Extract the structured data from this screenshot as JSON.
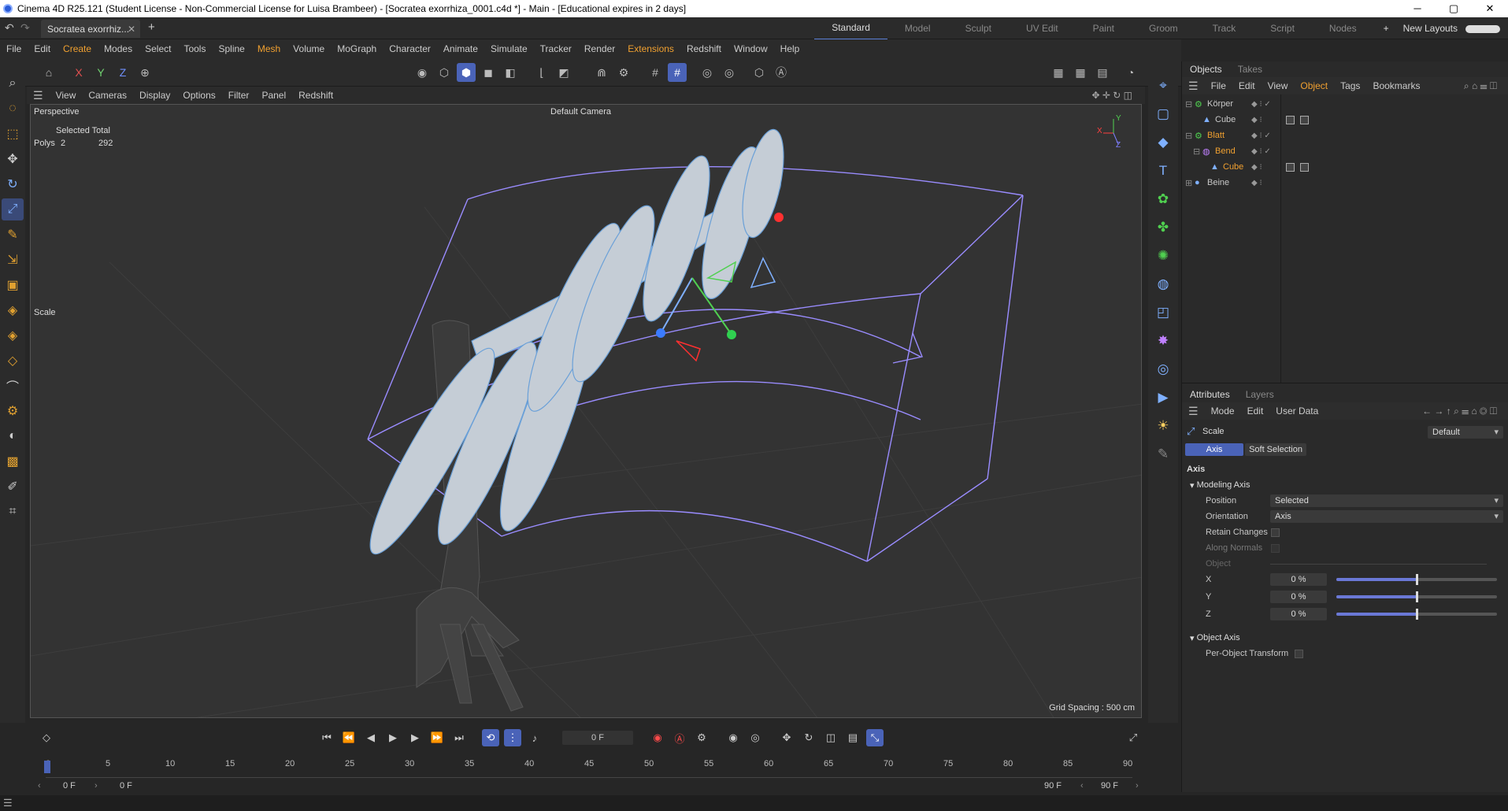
{
  "titlebar": {
    "title": "Cinema 4D R25.121 (Student License - Non-Commercial License for Luisa Brambeer) - [Socratea exorrhiza_0001.c4d *] - Main - [Educational expires in 2 days]",
    "minimize": "─",
    "maximize": "▢",
    "close": "✕"
  },
  "tabs": {
    "doc_tab": "Socratea exorrhiz...",
    "close": "✕",
    "add": "+"
  },
  "layouts": {
    "items": [
      "Standard",
      "Model",
      "Sculpt",
      "UV Edit",
      "Paint",
      "Groom",
      "Track",
      "Script",
      "Nodes"
    ],
    "add": "+",
    "new_layouts": "New Layouts"
  },
  "menu": {
    "items": [
      "File",
      "Edit",
      "Create",
      "Modes",
      "Select",
      "Tools",
      "Spline",
      "Mesh",
      "Volume",
      "MoGraph",
      "Character",
      "Animate",
      "Simulate",
      "Tracker",
      "Render",
      "Extensions",
      "Redshift",
      "Window",
      "Help"
    ]
  },
  "toolbar": {
    "x": "X",
    "y": "Y",
    "z": "Z"
  },
  "viewport_menu": {
    "items": [
      "View",
      "Cameras",
      "Display",
      "Options",
      "Filter",
      "Panel",
      "Redshift"
    ]
  },
  "viewport": {
    "view_name": "Perspective",
    "camera": "Default Camera",
    "selected_total": "Selected Total",
    "polys_label": "Polys",
    "polys_sel": "2",
    "polys_total": "292",
    "tool_name": "Scale",
    "grid_spacing": "Grid Spacing : 500 cm",
    "axis_x": "X",
    "axis_y": "Y",
    "axis_z": "Z"
  },
  "objects_panel": {
    "tabs": [
      "Objects",
      "Takes"
    ],
    "menu": [
      "File",
      "Edit",
      "View",
      "Object",
      "Tags",
      "Bookmarks"
    ],
    "rows": [
      {
        "name": "Körper",
        "color": "#c8c8c8"
      },
      {
        "name": "Cube",
        "color": "#c8c8c8"
      },
      {
        "name": "Blatt",
        "color": "#f0a030"
      },
      {
        "name": "Bend",
        "color": "#f0a030"
      },
      {
        "name": "Cube",
        "color": "#f0a030"
      },
      {
        "name": "Beine",
        "color": "#c8c8c8"
      }
    ]
  },
  "attributes_panel": {
    "tabs": [
      "Attributes",
      "Layers"
    ],
    "menu": [
      "Mode",
      "Edit",
      "User Data"
    ],
    "tool": "Scale",
    "preset": "Default",
    "subtabs": [
      "Axis",
      "Soft Selection"
    ],
    "section": "Axis",
    "modeling_axis": "Modeling Axis",
    "position_label": "Position",
    "position_value": "Selected",
    "orientation_label": "Orientation",
    "orientation_value": "Axis",
    "retain_changes": "Retain Changes",
    "along_normals": "Along Normals",
    "object_label": "Object",
    "x_label": "X",
    "x_value": "0 %",
    "y_label": "Y",
    "y_value": "0 %",
    "z_label": "Z",
    "z_value": "0 %",
    "slider_level": 0.5,
    "object_axis": "Object Axis",
    "per_object_transform": "Per-Object Transform"
  },
  "timeline": {
    "frame_field": "0 F",
    "ticks": [
      "0",
      "5",
      "10",
      "15",
      "20",
      "25",
      "30",
      "35",
      "40",
      "45",
      "50",
      "55",
      "60",
      "65",
      "70",
      "75",
      "80",
      "85",
      "90"
    ],
    "start": "0 F",
    "current": "0 F",
    "end_a": "90 F",
    "end_b": "90 F"
  },
  "colors": {
    "accent": "#4a63b8",
    "highlight": "#f0a030",
    "mesh": "#c5cdd6",
    "wire": "#9a8cff"
  }
}
